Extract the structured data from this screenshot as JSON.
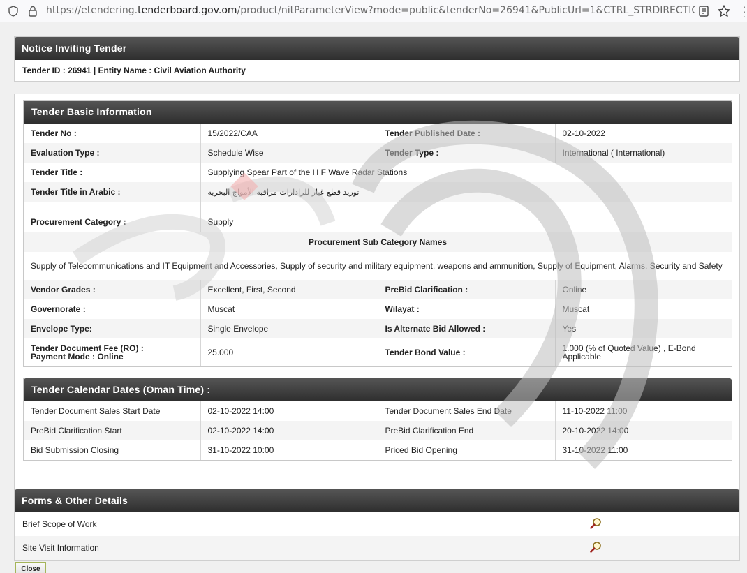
{
  "browser": {
    "url_prefix": "https://etendering.",
    "url_domain": "tenderboard.gov.om",
    "url_rest": "/product/nitParameterView?mode=public&tenderNo=26941&PublicUrl=1&CTRL_STRDIRECTION=LTR&encparar"
  },
  "notice": {
    "title": "Notice Inviting Tender",
    "subtitle": "Tender ID : 26941 | Entity Name : Civil Aviation Authority"
  },
  "basic": {
    "title": "Tender Basic Information",
    "tender_no_label": "Tender No :",
    "tender_no": "15/2022/CAA",
    "published_label": "Tender Published Date :",
    "published": "02-10-2022",
    "evaluation_label": "Evaluation Type :",
    "evaluation": "Schedule Wise",
    "type_label": "Tender Type :",
    "type": "International  ( International)",
    "title_label": "Tender Title :",
    "tender_title": "Supplying Spear Part of the H F Wave Radar Stations",
    "arabic_label": "Tender Title in Arabic :",
    "arabic_title": "توريد قطع غيار للرادارات مراقبة الأمواج البحرية",
    "procurement_label": "Procurement Category :",
    "procurement": "Supply",
    "subcategory_heading": "Procurement Sub Category Names",
    "subcategories": "Supply of Telecommunications and IT Equipment and Accessories, Supply of security and military equipment, weapons and ammunition, Supply of Equipment, Alarms, Security and Safety",
    "grades_label": "Vendor Grades :",
    "grades": "Excellent, First, Second",
    "prebid_label": "PreBid Clarification :",
    "prebid": "Online",
    "gov_label": "Governorate :",
    "gov": "Muscat",
    "wilayat_label": "Wilayat :",
    "wilayat": "Muscat",
    "envelope_label": "Envelope Type:",
    "envelope": "Single Envelope",
    "alternate_label": "Is Alternate Bid Allowed :",
    "alternate": "Yes",
    "fee_label": "Tender Document Fee (RO) :",
    "payment_label": "Payment Mode :  Online",
    "fee": "25.000",
    "bond_label": "Tender Bond Value :",
    "bond": "1.000 (% of Quoted Value) , E-Bond Applicable"
  },
  "calendar": {
    "title": "Tender Calendar Dates (Oman Time) :",
    "rows": [
      {
        "l1": "Tender Document Sales Start Date",
        "v1": "02-10-2022 14:00",
        "l2": "Tender Document Sales End Date",
        "v2": "11-10-2022 11:00"
      },
      {
        "l1": "PreBid Clarification Start",
        "v1": "02-10-2022 14:00",
        "l2": "PreBid Clarification End",
        "v2": "20-10-2022 14:00"
      },
      {
        "l1": "Bid Submission Closing",
        "v1": "31-10-2022 10:00",
        "l2": "Priced Bid Opening",
        "v2": "31-10-2022 11:00"
      }
    ]
  },
  "forms": {
    "title": "Forms & Other Details",
    "items": [
      {
        "label": "Brief Scope of Work",
        "icon": "magnifier-icon"
      },
      {
        "label": "Site Visit Information",
        "icon": "magnifier-icon"
      }
    ]
  },
  "close_label": "Close"
}
